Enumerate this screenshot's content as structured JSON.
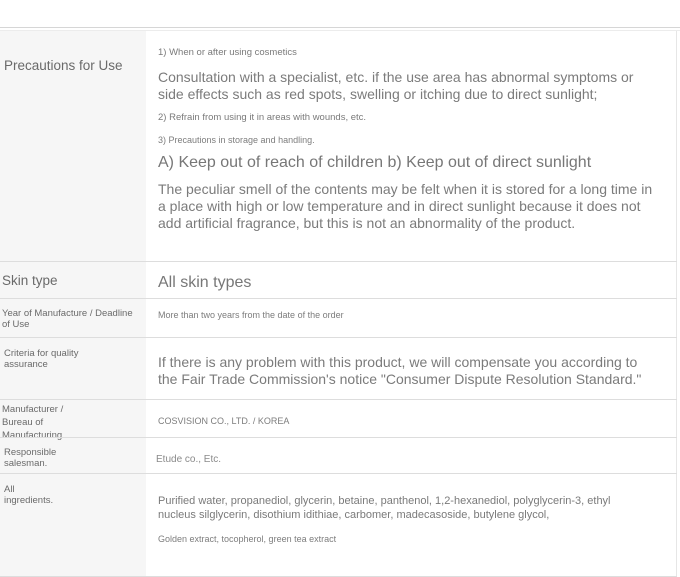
{
  "table": {
    "precautions": {
      "label": "Precautions for Use",
      "line1": "1) When or after using cosmetics",
      "para1": "Consultation with a specialist, etc. if the use area has abnormal symptoms or side effects such as red spots, swelling or itching due to direct sunlight;",
      "line2": "2) Refrain from using it in areas with wounds, etc.",
      "line3": "3) Precautions in storage and handling.",
      "para2": "A) Keep out of reach of children b) Keep out of direct sunlight",
      "para3": "The peculiar smell of the contents may be felt when it is stored for a long time in a place with high or low temperature and in direct sunlight because it does not add artificial fragrance, but this is not an abnormality of the product."
    },
    "skin_type": {
      "label": "Skin type",
      "value": "All skin types"
    },
    "year": {
      "label": "Year of Manufacture / Deadline of Use",
      "value": "More than two years from the date of the order"
    },
    "criteria": {
      "label": "Criteria for quality assurance",
      "value": "If there is any problem with this product, we will compensate you according to the Fair Trade Commission's notice \"Consumer Dispute Resolution Standard.\""
    },
    "manufacturer": {
      "label": "Manufacturer / Bureau of Manufacturing",
      "value": "COSVISION CO., LTD. / KOREA"
    },
    "salesman": {
      "label": "Responsible salesman.",
      "value": "Etude co., Etc."
    },
    "ingredients": {
      "label": "All ingredients.",
      "value": "Purified water, propanediol, glycerin, betaine, panthenol, 1,2-hexanediol, polyglycerin-3, ethyl nucleus silglycerin, disothium idithiae, carbomer, madecasoside, butylene glycol,",
      "value2": "Golden extract, tocopherol, green tea extract"
    }
  }
}
